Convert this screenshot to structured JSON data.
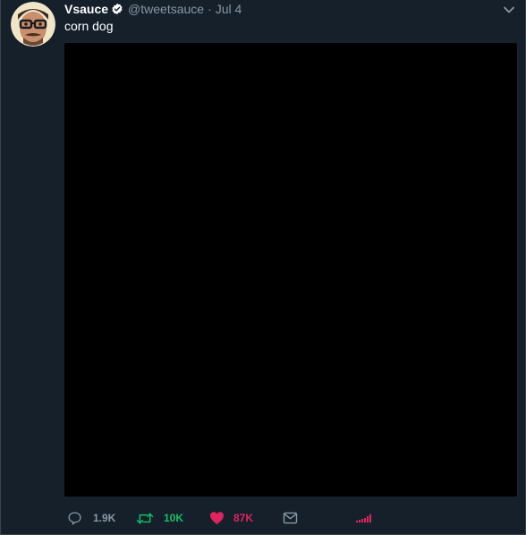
{
  "tweet": {
    "author": {
      "name": "Vsauce",
      "handle": "@tweetsauce",
      "verified": true
    },
    "separator": "·",
    "date": "Jul 4",
    "text": "corn dog",
    "stats": {
      "replies": "1.9K",
      "retweets": "10K",
      "likes": "87K"
    }
  },
  "colors": {
    "background": "#15202b",
    "text_primary": "#ffffff",
    "text_secondary": "#8899a6",
    "verified": "#ffffff",
    "retweet_active": "#17bf63",
    "like_active": "#e0245e",
    "media_background": "#000000"
  },
  "icons": {
    "reply": "speech-bubble-icon",
    "retweet": "retweet-arrows-icon",
    "like": "heart-icon",
    "dm": "envelope-icon",
    "analytics": "bar-chart-icon",
    "menu": "chevron-down-icon",
    "verified": "verified-badge-icon"
  }
}
